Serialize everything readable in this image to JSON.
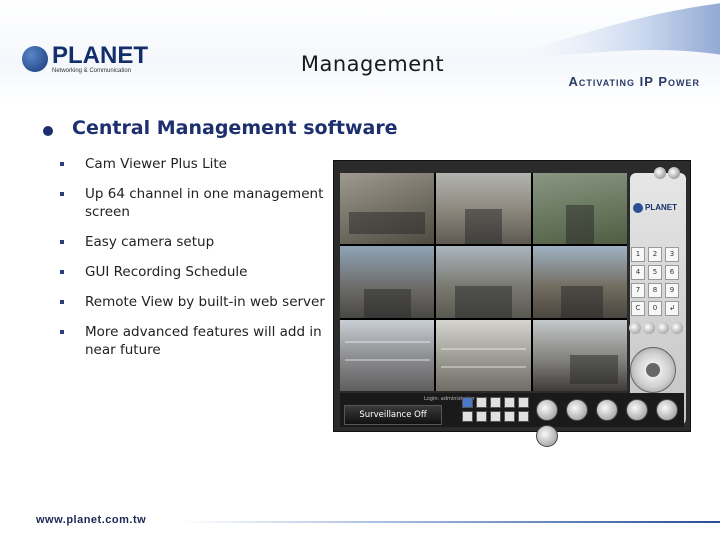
{
  "header": {
    "logo_text": "PLANET",
    "logo_tagline": "Networking & Communication",
    "title": "Management",
    "tagline": "Activating IP Power"
  },
  "section": {
    "heading": "Central Management software",
    "bullets": [
      "Cam Viewer Plus Lite",
      "Up 64 channel in one management screen",
      "Easy camera setup",
      "GUI Recording Schedule",
      "Remote View by built-in web server",
      "More advanced features will add in near future"
    ]
  },
  "screenshot": {
    "status_text": "Surveillance Off",
    "login_text": "Login: administrator",
    "keypad": [
      "1",
      "2",
      "3",
      "4",
      "5",
      "6",
      "7",
      "8",
      "9",
      "C",
      "0",
      "↲"
    ],
    "logo_text": "PLANET"
  },
  "footer": {
    "url": "www.planet.com.tw"
  },
  "colors": {
    "heading": "#1d2f6e",
    "brand_dark": "#132f6b"
  }
}
